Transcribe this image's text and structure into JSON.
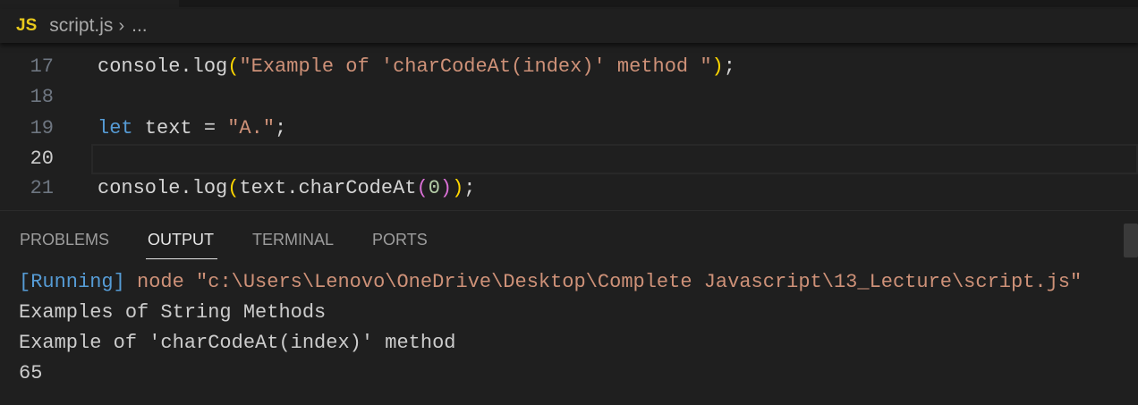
{
  "breadcrumb": {
    "file_icon": "JS",
    "file": "script.js",
    "more": "..."
  },
  "editor": {
    "lines": [
      {
        "num": "17",
        "parts": [
          "console.log",
          "(",
          "\"Example of 'charCodeAt(index)' method \"",
          ")",
          ";"
        ]
      },
      {
        "num": "18"
      },
      {
        "num": "19",
        "parts": [
          "let",
          " text = ",
          "\"A.\"",
          ";"
        ]
      },
      {
        "num": "20"
      },
      {
        "num": "21",
        "parts": [
          "console.log",
          "(",
          "text.charCodeAt",
          "(",
          "0",
          ")",
          ")",
          ";"
        ]
      }
    ]
  },
  "panel": {
    "tabs": [
      "PROBLEMS",
      "OUTPUT",
      "TERMINAL",
      "PORTS"
    ],
    "active_tab": "OUTPUT",
    "output": {
      "running_tag": "[Running]",
      "command": " node \"c:\\Users\\Lenovo\\OneDrive\\Desktop\\Complete Javascript\\13_Lecture\\script.js\"",
      "lines": [
        "Examples of String Methods",
        "Example of 'charCodeAt(index)' method",
        "65"
      ]
    }
  }
}
